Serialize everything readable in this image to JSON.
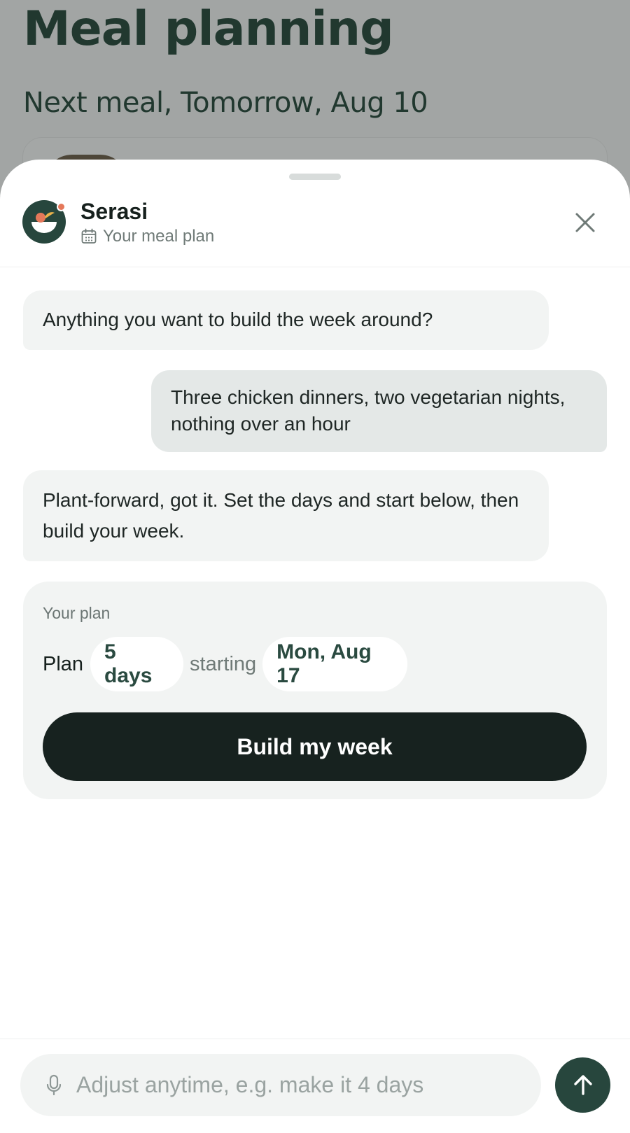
{
  "background_page": {
    "title": "Meal planning",
    "subtitle": "Next meal, Tomorrow, Aug 10"
  },
  "sheet": {
    "assistant": {
      "name": "Serasi",
      "context_label": "Your meal plan",
      "context_icon": "calendar-icon",
      "avatar_icon": "bowl-icon"
    },
    "close_icon": "close-icon",
    "messages": [
      {
        "role": "assistant",
        "text": "Anything you want to build the week around?"
      },
      {
        "role": "user",
        "text": "Three chicken dinners, two vegetarian nights, nothing over an hour"
      },
      {
        "role": "assistant",
        "text": "Plant-forward, got it. Set the days and start below, then build your week."
      }
    ],
    "plan_card": {
      "label": "Your plan",
      "plan_word": "Plan",
      "days_value": "5 days",
      "starting_word": "starting",
      "start_date": "Mon, Aug 17",
      "build_button": "Build my week"
    },
    "composer": {
      "placeholder": "Adjust anytime, e.g. make it 4 days",
      "value": "",
      "mic_icon": "microphone-icon",
      "send_icon": "arrow-up-icon"
    }
  },
  "colors": {
    "brand_green": "#27463d",
    "dark_button": "#17221f",
    "accent_dot": "#e5785a",
    "bubble_assistant": "#f2f4f3",
    "bubble_user": "#e4e8e7"
  }
}
